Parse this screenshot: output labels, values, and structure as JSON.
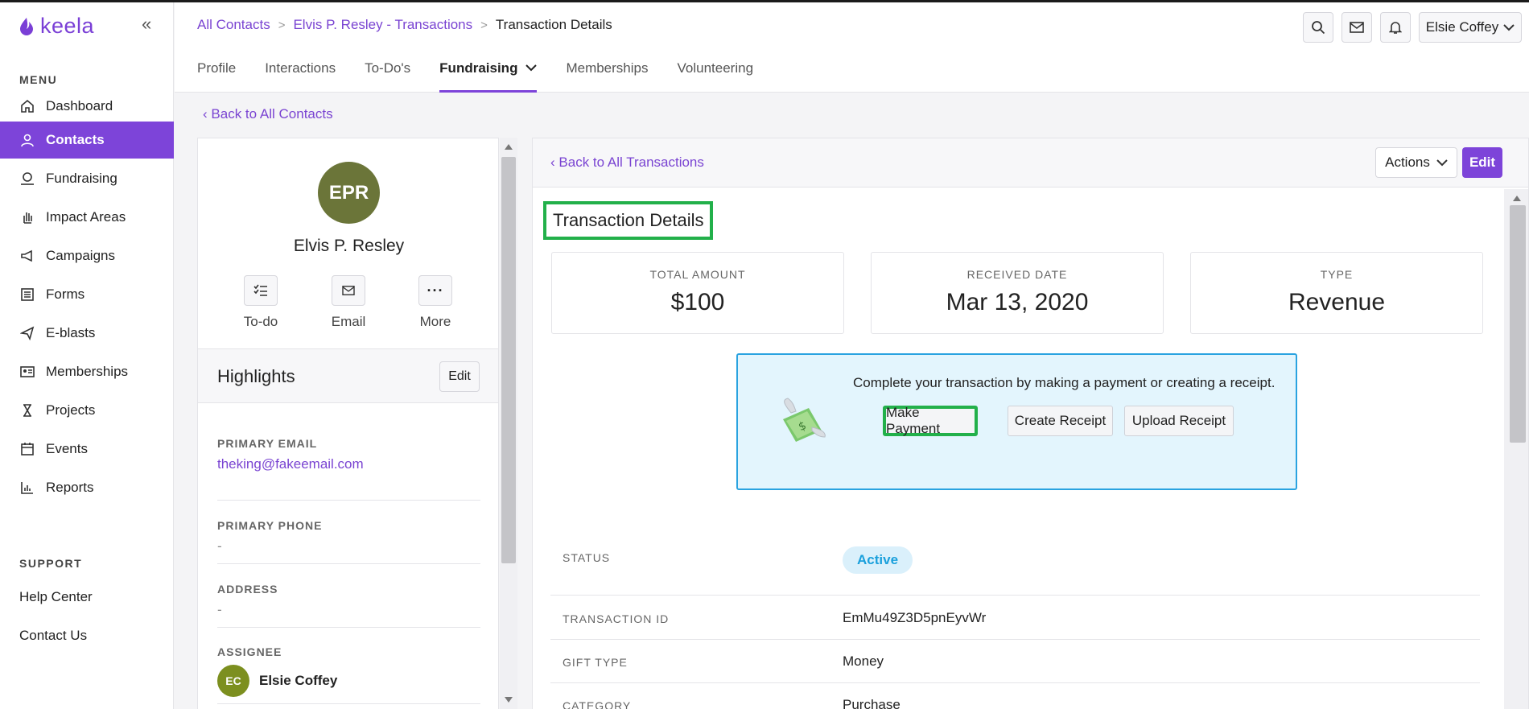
{
  "app": {
    "logo": "keela"
  },
  "sidebar": {
    "menu_label": "MENU",
    "items": [
      {
        "label": "Dashboard",
        "icon": "home-icon"
      },
      {
        "label": "Contacts",
        "icon": "user-icon",
        "active": true
      },
      {
        "label": "Fundraising",
        "icon": "donation-icon"
      },
      {
        "label": "Impact Areas",
        "icon": "hand-icon"
      },
      {
        "label": "Campaigns",
        "icon": "megaphone-icon"
      },
      {
        "label": "Forms",
        "icon": "list-icon"
      },
      {
        "label": "E-blasts",
        "icon": "paper-plane-icon"
      },
      {
        "label": "Memberships",
        "icon": "id-card-icon"
      },
      {
        "label": "Projects",
        "icon": "hourglass-icon"
      },
      {
        "label": "Events",
        "icon": "calendar-icon"
      },
      {
        "label": "Reports",
        "icon": "bar-chart-icon"
      }
    ],
    "support_label": "SUPPORT",
    "support_items": [
      "Help Center",
      "Contact Us"
    ]
  },
  "header": {
    "breadcrumb": [
      "All Contacts",
      "Elvis P. Resley - Transactions",
      "Transaction Details"
    ],
    "user": "Elsie Coffey",
    "tabs": [
      "Profile",
      "Interactions",
      "To-Do's",
      "Fundraising",
      "Memberships",
      "Volunteering"
    ],
    "active_tab": "Fundraising"
  },
  "back_to_contacts": "Back to All Contacts",
  "contact": {
    "initials": "EPR",
    "name": "Elvis P. Resley",
    "actions": [
      "To-do",
      "Email",
      "More"
    ],
    "highlights_title": "Highlights",
    "edit_label": "Edit",
    "fields": [
      {
        "label": "PRIMARY EMAIL",
        "value": "theking@fakeemail.com"
      },
      {
        "label": "PRIMARY PHONE",
        "value": "-"
      },
      {
        "label": "ADDRESS",
        "value": "-"
      }
    ],
    "assignee": {
      "label": "ASSIGNEE",
      "initials": "EC",
      "name": "Elsie Coffey"
    }
  },
  "transaction": {
    "back_label": "Back to All Transactions",
    "actions_label": "Actions",
    "edit_label": "Edit",
    "title": "Transaction Details",
    "stats": [
      {
        "label": "TOTAL AMOUNT",
        "value": "$100"
      },
      {
        "label": "RECEIVED DATE",
        "value": "Mar 13, 2020"
      },
      {
        "label": "TYPE",
        "value": "Revenue"
      }
    ],
    "payment": {
      "message": "Complete your transaction by making a payment or creating a receipt.",
      "buttons": [
        "Make Payment",
        "Create Receipt",
        "Upload Receipt"
      ]
    },
    "details": [
      {
        "label": "STATUS",
        "value": "Active"
      },
      {
        "label": "TRANSACTION ID",
        "value": "EmMu49Z3D5pnEyvWr"
      },
      {
        "label": "GIFT TYPE",
        "value": "Money"
      },
      {
        "label": "CATEGORY",
        "value": "Purchase"
      }
    ]
  },
  "colors": {
    "brand": "#7d44d9",
    "highlight": "#22b04a",
    "info": "#2aa3e0"
  }
}
